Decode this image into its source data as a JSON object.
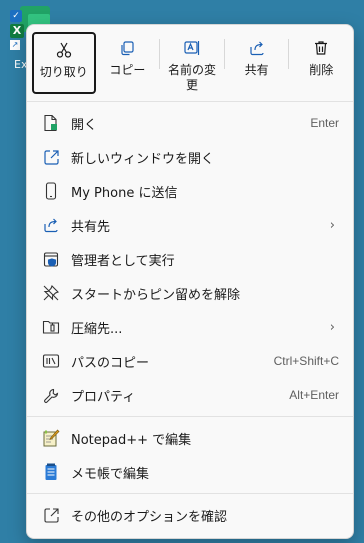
{
  "desktop": {
    "icon_label": "Ex"
  },
  "toolbar": [
    {
      "label": "切り取り",
      "icon": "cut-icon"
    },
    {
      "label": "コピー",
      "icon": "copy-icon"
    },
    {
      "label": "名前の変更",
      "icon": "rename-icon"
    },
    {
      "label": "共有",
      "icon": "share-icon"
    },
    {
      "label": "削除",
      "icon": "delete-icon"
    }
  ],
  "menu": {
    "open": {
      "label": "開く",
      "shortcut": "Enter"
    },
    "open_new_window": {
      "label": "新しいウィンドウを開く"
    },
    "send_to_phone": {
      "label": "My Phone に送信"
    },
    "share_to": {
      "label": "共有先"
    },
    "run_as_admin": {
      "label": "管理者として実行"
    },
    "unpin_start": {
      "label": "スタートからピン留めを解除"
    },
    "compress_to": {
      "label": "圧縮先..."
    },
    "copy_path": {
      "label": "パスのコピー",
      "shortcut": "Ctrl+Shift+C"
    },
    "properties": {
      "label": "プロパティ",
      "shortcut": "Alt+Enter"
    },
    "notepadpp": {
      "label": "Notepad++ で編集"
    },
    "notepad": {
      "label": "メモ帳で編集"
    },
    "more_options": {
      "label": "その他のオプションを確認"
    }
  }
}
